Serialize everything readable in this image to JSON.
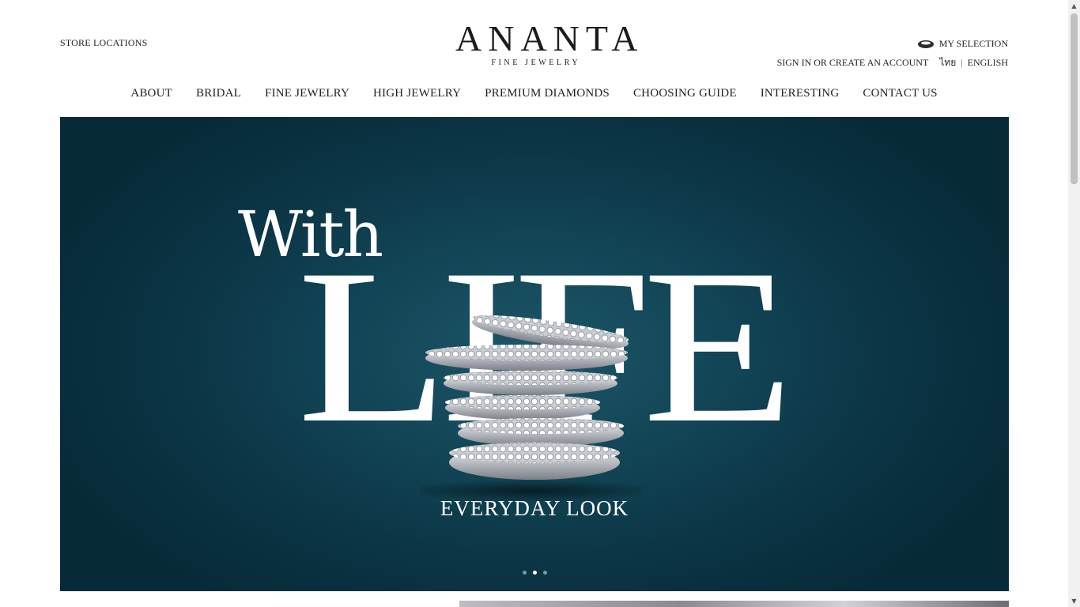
{
  "header": {
    "store_locations": "STORE LOCATIONS",
    "logo_name": "ANANTA",
    "logo_sub": "FINE JEWELRY",
    "my_selection": "MY SELECTION",
    "account": "SIGN IN OR CREATE AN ACCOUNT",
    "lang_thai": "ไทย",
    "lang_sep": "|",
    "lang_english": "ENGLISH"
  },
  "nav": {
    "items": [
      "ABOUT",
      "BRIDAL",
      "FINE JEWELRY",
      "HIGH JEWELRY",
      "PREMIUM DIAMONDS",
      "CHOOSING GUIDE",
      "INTERESTING",
      "CONTACT US"
    ]
  },
  "hero": {
    "line1": "With",
    "line2": "LIFE",
    "caption": "EVERYDAY LOOK",
    "slide_count": 3,
    "active_slide": 2
  },
  "colors": {
    "hero_bg": "#0b3444",
    "accent": "#222222"
  }
}
